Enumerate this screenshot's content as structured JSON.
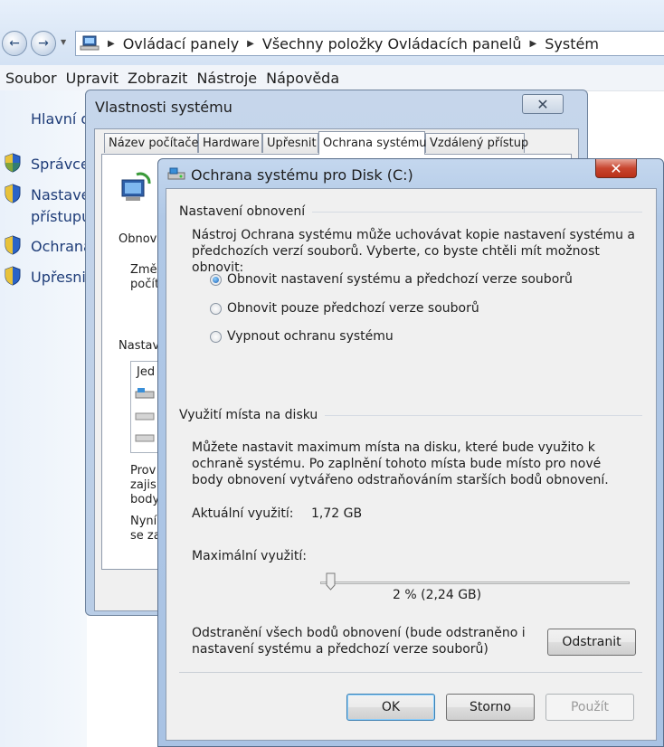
{
  "explorer": {
    "breadcrumb": [
      "Ovládací panely",
      "Všechny položky Ovládacích panelů",
      "Systém"
    ],
    "menu": [
      "Soubor",
      "Upravit",
      "Zobrazit",
      "Nástroje",
      "Nápověda"
    ]
  },
  "left_pane": {
    "title": "Hlavní o",
    "items": [
      "Správce",
      "Nastave",
      "přístupu",
      "Ochrana",
      "Upřesni"
    ]
  },
  "system_properties": {
    "title": "Vlastnosti systému",
    "tabs": [
      "Název počítače",
      "Hardware",
      "Upřesnit",
      "Ochrana systému",
      "Vzdálený přístup"
    ],
    "active_tab": "Ochrana systému",
    "partial_texts": [
      "Obnove",
      "Změ",
      "počít",
      "Nastav",
      "Jed",
      "Prov",
      "zajis",
      "body",
      "Nyní",
      "se za"
    ]
  },
  "protection_dialog": {
    "title": "Ochrana systému pro Disk (C:)",
    "restore_settings": {
      "label": "Nastavení obnovení",
      "description": "Nástroj Ochrana systému může uchovávat kopie nastavení systému a předchozích verzí souborů. Vyberte, co byste chtěli mít možnost obnovit:",
      "options": [
        {
          "label": "Obnovit nastavení systému a předchozí verze souborů",
          "selected": true
        },
        {
          "label": "Obnovit pouze předchozí verze souborů",
          "selected": false
        },
        {
          "label": "Vypnout ochranu systému",
          "selected": false
        }
      ]
    },
    "disk_usage": {
      "label": "Využití místa na disku",
      "description": "Můžete nastavit maximum místa na disku, které bude využito k ochraně systému. Po zaplnění tohoto místa bude místo pro nové body obnovení vytvářeno odstraňováním starších bodů obnovení.",
      "current_label": "Aktuální využití:",
      "current_value": "1,72 GB",
      "max_label": "Maximální využití:",
      "max_percent": 2,
      "max_value_text": "2 % (2,24 GB)"
    },
    "delete": {
      "text": "Odstranění všech bodů obnovení (bude odstraněno i nastavení systému a předchozí verze souborů)",
      "button": "Odstranit"
    },
    "buttons": {
      "ok": "OK",
      "cancel": "Storno",
      "apply": "Použít"
    }
  },
  "colors": {
    "accent": "#1a5fb4",
    "close_red": "#c8452f",
    "link_blue": "#1e3c78"
  }
}
